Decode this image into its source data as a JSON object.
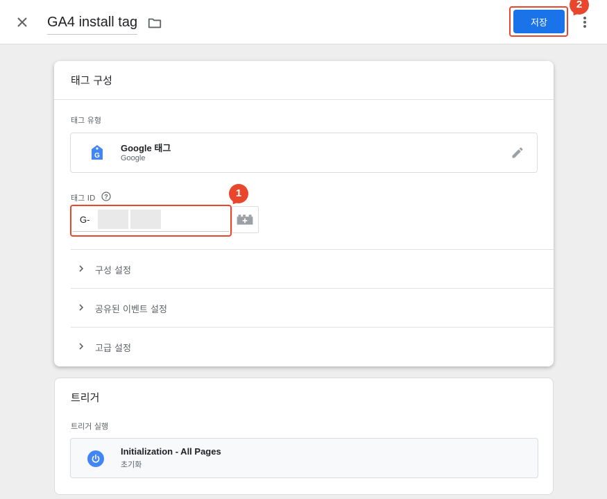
{
  "header": {
    "tag_name": "GA4 install tag",
    "save_label": "저장"
  },
  "annotations": {
    "badge_1": "1",
    "badge_2": "2",
    "accent_color": "#e8472e"
  },
  "tag_config": {
    "title": "태그 구성",
    "tag_type_label": "태그 유형",
    "tag_type": {
      "name": "Google 태그",
      "vendor": "Google",
      "icon": "google-tag-icon"
    },
    "tag_id_label": "태그 ID",
    "tag_id_value": "G-",
    "sections": [
      {
        "label": "구성 설정"
      },
      {
        "label": "공유된 이벤트 설정"
      },
      {
        "label": "고급 설정"
      }
    ]
  },
  "triggers": {
    "title": "트리거",
    "firing_label": "트리거 실행",
    "items": [
      {
        "name": "Initialization - All Pages",
        "type": "초기화",
        "icon": "power-icon"
      }
    ]
  },
  "colors": {
    "primary": "#1a73e8",
    "background": "#eeeeee"
  }
}
